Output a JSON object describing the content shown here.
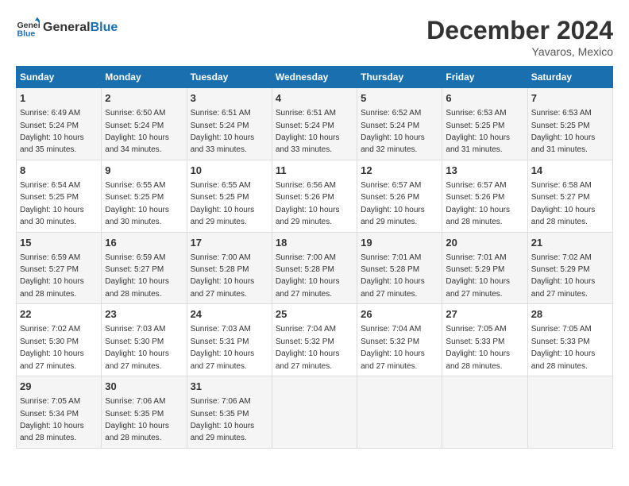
{
  "logo": {
    "line1": "General",
    "line2": "Blue"
  },
  "title": "December 2024",
  "location": "Yavaros, Mexico",
  "days_of_week": [
    "Sunday",
    "Monday",
    "Tuesday",
    "Wednesday",
    "Thursday",
    "Friday",
    "Saturday"
  ],
  "weeks": [
    [
      {
        "day": "1",
        "sunrise": "6:49 AM",
        "sunset": "5:24 PM",
        "daylight": "10 hours and 35 minutes."
      },
      {
        "day": "2",
        "sunrise": "6:50 AM",
        "sunset": "5:24 PM",
        "daylight": "10 hours and 34 minutes."
      },
      {
        "day": "3",
        "sunrise": "6:51 AM",
        "sunset": "5:24 PM",
        "daylight": "10 hours and 33 minutes."
      },
      {
        "day": "4",
        "sunrise": "6:51 AM",
        "sunset": "5:24 PM",
        "daylight": "10 hours and 33 minutes."
      },
      {
        "day": "5",
        "sunrise": "6:52 AM",
        "sunset": "5:24 PM",
        "daylight": "10 hours and 32 minutes."
      },
      {
        "day": "6",
        "sunrise": "6:53 AM",
        "sunset": "5:25 PM",
        "daylight": "10 hours and 31 minutes."
      },
      {
        "day": "7",
        "sunrise": "6:53 AM",
        "sunset": "5:25 PM",
        "daylight": "10 hours and 31 minutes."
      }
    ],
    [
      {
        "day": "8",
        "sunrise": "6:54 AM",
        "sunset": "5:25 PM",
        "daylight": "10 hours and 30 minutes."
      },
      {
        "day": "9",
        "sunrise": "6:55 AM",
        "sunset": "5:25 PM",
        "daylight": "10 hours and 30 minutes."
      },
      {
        "day": "10",
        "sunrise": "6:55 AM",
        "sunset": "5:25 PM",
        "daylight": "10 hours and 29 minutes."
      },
      {
        "day": "11",
        "sunrise": "6:56 AM",
        "sunset": "5:26 PM",
        "daylight": "10 hours and 29 minutes."
      },
      {
        "day": "12",
        "sunrise": "6:57 AM",
        "sunset": "5:26 PM",
        "daylight": "10 hours and 29 minutes."
      },
      {
        "day": "13",
        "sunrise": "6:57 AM",
        "sunset": "5:26 PM",
        "daylight": "10 hours and 28 minutes."
      },
      {
        "day": "14",
        "sunrise": "6:58 AM",
        "sunset": "5:27 PM",
        "daylight": "10 hours and 28 minutes."
      }
    ],
    [
      {
        "day": "15",
        "sunrise": "6:59 AM",
        "sunset": "5:27 PM",
        "daylight": "10 hours and 28 minutes."
      },
      {
        "day": "16",
        "sunrise": "6:59 AM",
        "sunset": "5:27 PM",
        "daylight": "10 hours and 28 minutes."
      },
      {
        "day": "17",
        "sunrise": "7:00 AM",
        "sunset": "5:28 PM",
        "daylight": "10 hours and 27 minutes."
      },
      {
        "day": "18",
        "sunrise": "7:00 AM",
        "sunset": "5:28 PM",
        "daylight": "10 hours and 27 minutes."
      },
      {
        "day": "19",
        "sunrise": "7:01 AM",
        "sunset": "5:28 PM",
        "daylight": "10 hours and 27 minutes."
      },
      {
        "day": "20",
        "sunrise": "7:01 AM",
        "sunset": "5:29 PM",
        "daylight": "10 hours and 27 minutes."
      },
      {
        "day": "21",
        "sunrise": "7:02 AM",
        "sunset": "5:29 PM",
        "daylight": "10 hours and 27 minutes."
      }
    ],
    [
      {
        "day": "22",
        "sunrise": "7:02 AM",
        "sunset": "5:30 PM",
        "daylight": "10 hours and 27 minutes."
      },
      {
        "day": "23",
        "sunrise": "7:03 AM",
        "sunset": "5:30 PM",
        "daylight": "10 hours and 27 minutes."
      },
      {
        "day": "24",
        "sunrise": "7:03 AM",
        "sunset": "5:31 PM",
        "daylight": "10 hours and 27 minutes."
      },
      {
        "day": "25",
        "sunrise": "7:04 AM",
        "sunset": "5:32 PM",
        "daylight": "10 hours and 27 minutes."
      },
      {
        "day": "26",
        "sunrise": "7:04 AM",
        "sunset": "5:32 PM",
        "daylight": "10 hours and 27 minutes."
      },
      {
        "day": "27",
        "sunrise": "7:05 AM",
        "sunset": "5:33 PM",
        "daylight": "10 hours and 28 minutes."
      },
      {
        "day": "28",
        "sunrise": "7:05 AM",
        "sunset": "5:33 PM",
        "daylight": "10 hours and 28 minutes."
      }
    ],
    [
      {
        "day": "29",
        "sunrise": "7:05 AM",
        "sunset": "5:34 PM",
        "daylight": "10 hours and 28 minutes."
      },
      {
        "day": "30",
        "sunrise": "7:06 AM",
        "sunset": "5:35 PM",
        "daylight": "10 hours and 28 minutes."
      },
      {
        "day": "31",
        "sunrise": "7:06 AM",
        "sunset": "5:35 PM",
        "daylight": "10 hours and 29 minutes."
      },
      null,
      null,
      null,
      null
    ]
  ]
}
